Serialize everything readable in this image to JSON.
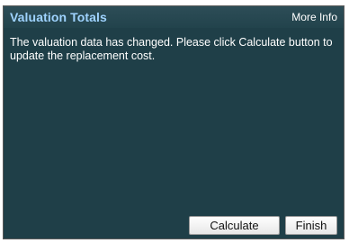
{
  "panel": {
    "title": "Valuation Totals",
    "more_info_label": "More Info",
    "message": "The valuation data has changed. Please click Calculate button to update the replacement cost."
  },
  "buttons": {
    "calculate_label": "Calculate",
    "finish_label": "Finish"
  },
  "colors": {
    "panel_background": "#1f3f48",
    "title_color": "#9fd3ff",
    "text_color": "#ffffff"
  }
}
